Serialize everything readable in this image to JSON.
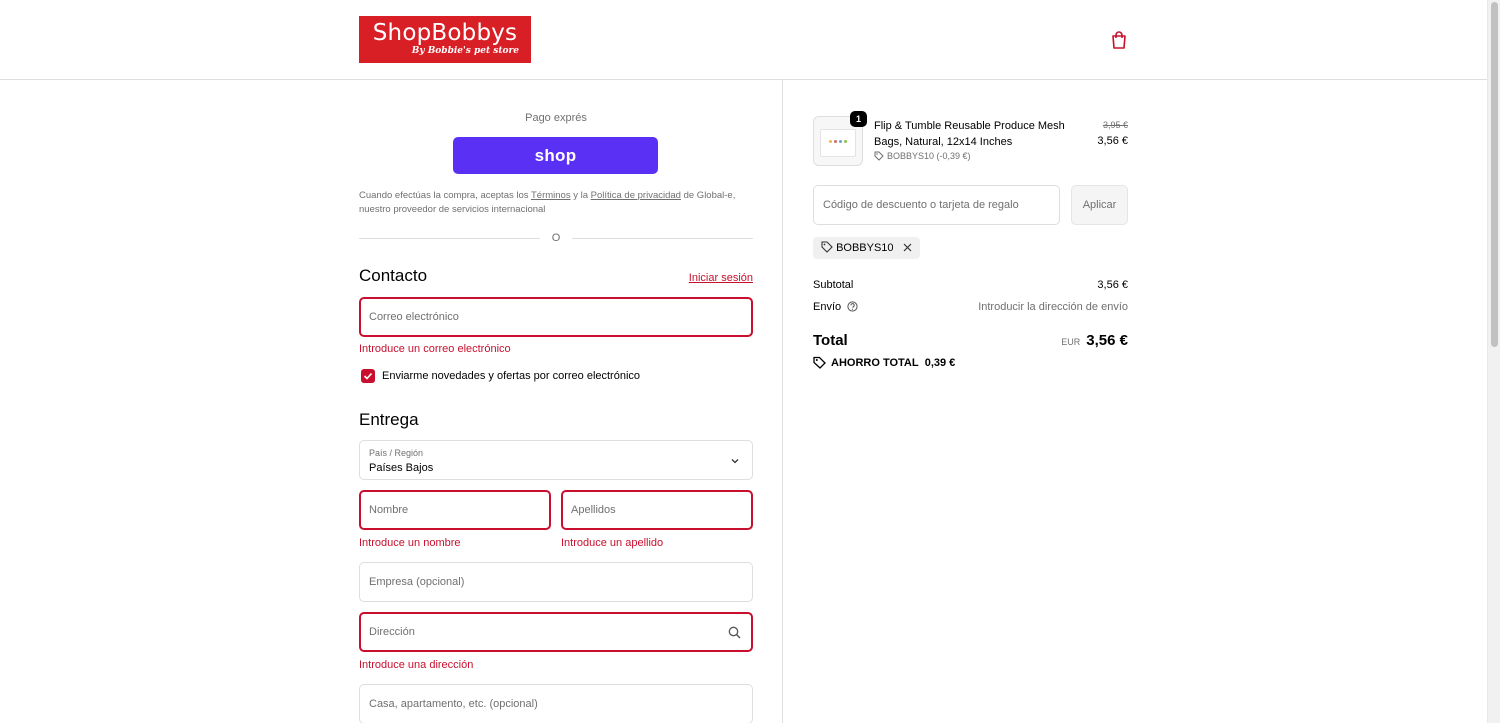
{
  "header": {
    "logo_text": "ShopBobbys",
    "logo_sub": "By Bobbie's pet store",
    "bag_icon": "shopping-bag-icon",
    "accent": "#d81f26"
  },
  "express": {
    "label": "Pago exprés",
    "shop_button": "shop",
    "terms_prefix": "Cuando efectúas la compra, aceptas los ",
    "terms_link": "Términos",
    "terms_mid": " y la ",
    "privacy_link": "Política de privacidad",
    "terms_suffix": " de Global-e, nuestro proveedor de servicios internacional",
    "or": "O"
  },
  "contact": {
    "title": "Contacto",
    "login": "Iniciar sesión",
    "email_placeholder": "Correo electrónico",
    "email_error": "Introduce un correo electrónico",
    "newsletter": "Enviarme novedades y ofertas por correo electrónico",
    "newsletter_checked": true
  },
  "delivery": {
    "title": "Entrega",
    "country_label": "País / Región",
    "country_value": "Países Bajos",
    "first_name": "Nombre",
    "first_name_error": "Introduce un nombre",
    "last_name": "Apellidos",
    "last_name_error": "Introduce un apellido",
    "company": "Empresa (opcional)",
    "address": "Dirección",
    "address_error": "Introduce una dirección",
    "apartment": "Casa, apartamento, etc. (opcional)"
  },
  "summary": {
    "product": {
      "name": "Flip & Tumble Reusable Produce Mesh Bags, Natural, 12x14 Inches",
      "quantity": "1",
      "discount": "BOBBYS10 (-0,39 €)",
      "price_old": "3,95 €",
      "price_new": "3,56 €"
    },
    "code_placeholder": "Código de descuento o tarjeta de regalo",
    "apply": "Aplicar",
    "applied_code": "BOBBYS10",
    "subtotal_label": "Subtotal",
    "subtotal_value": "3,56 €",
    "shipping_label": "Envío",
    "shipping_value": "Introducir la dirección de envío",
    "total_label": "Total",
    "total_currency": "EUR",
    "total_value": "3,56 €",
    "savings_label": "AHORRO TOTAL",
    "savings_value": "0,39 €"
  },
  "colors": {
    "error": "#c8102e",
    "shop_pay": "#5a31f4"
  }
}
